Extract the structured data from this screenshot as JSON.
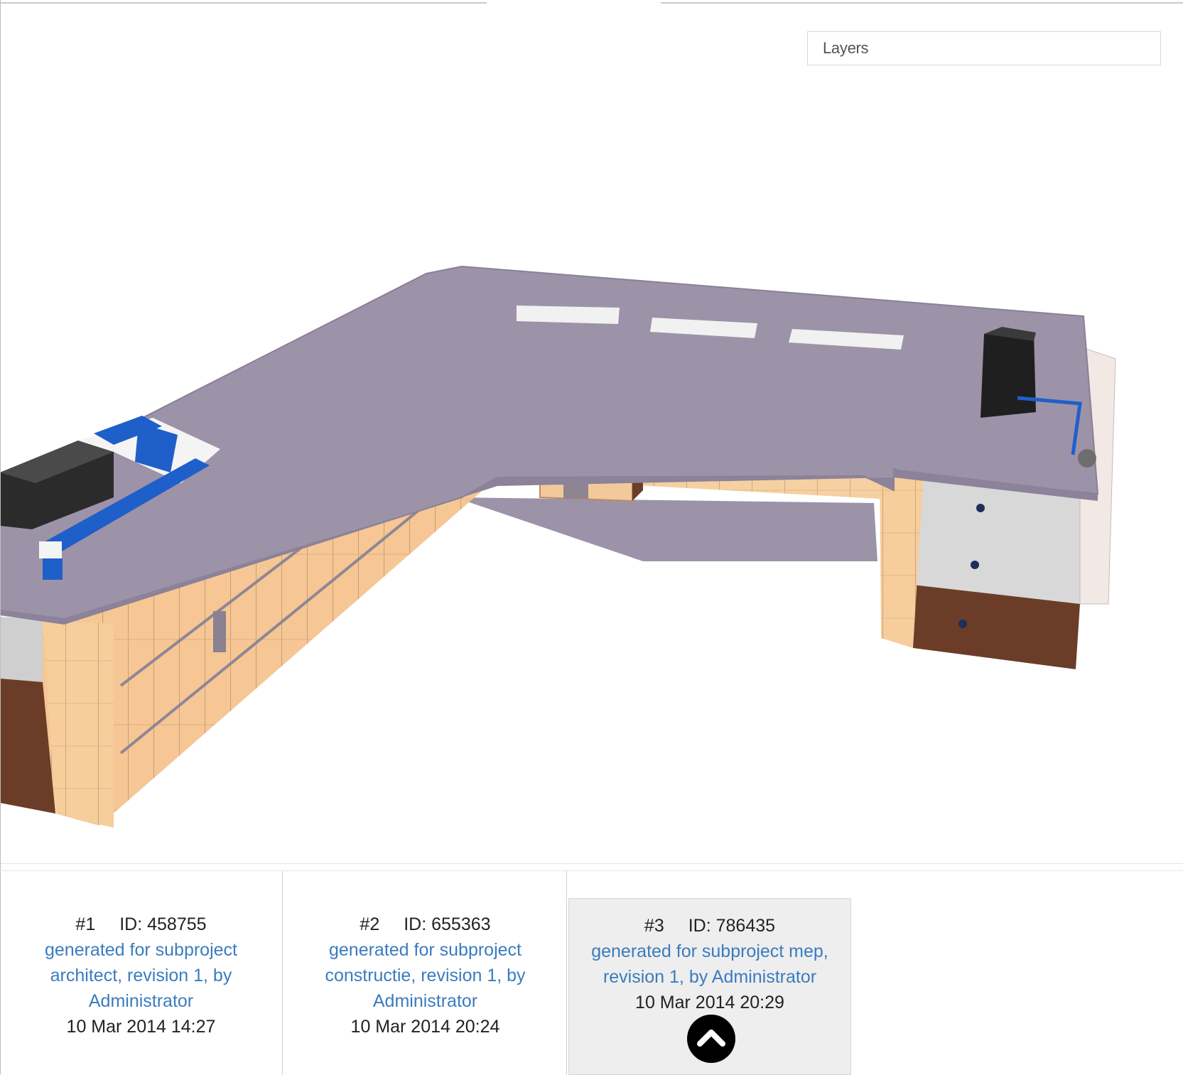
{
  "layers": {
    "label": "Layers"
  },
  "revisions": [
    {
      "number": "#1",
      "id": "ID: 458755",
      "comment": "generated for subproject architect, revision 1, by Administrator",
      "date": "10 Mar 2014 14:27",
      "active": false
    },
    {
      "number": "#2",
      "id": "ID: 655363",
      "comment": "generated for subproject constructie, revision 1, by Administrator",
      "date": "10 Mar 2014 20:24",
      "active": false
    },
    {
      "number": "#3",
      "id": "ID: 786435",
      "comment": "generated for subproject mep, revision 1, by Administrator",
      "date": "10 Mar 2014 20:29",
      "active": true
    }
  ],
  "scroll_top": {
    "icon": "chevron-up-icon"
  }
}
